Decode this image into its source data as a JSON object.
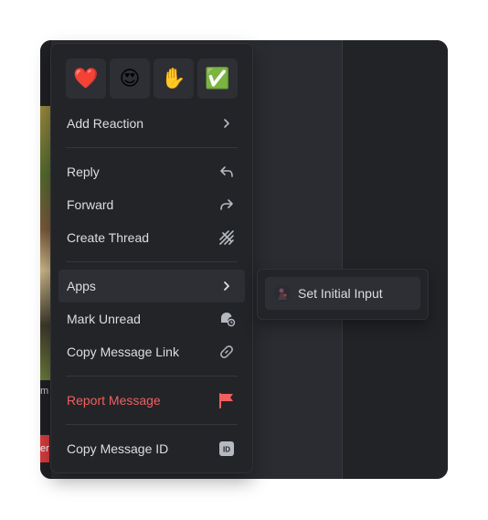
{
  "background": {
    "caption": "m",
    "red_button": "er"
  },
  "reactions": [
    {
      "name": "heart",
      "glyph": "❤️"
    },
    {
      "name": "heart-eyes",
      "glyph": "😍"
    },
    {
      "name": "raised-hand",
      "glyph": "✋"
    },
    {
      "name": "check-mark",
      "glyph": "✅"
    }
  ],
  "menu": {
    "add_reaction": "Add Reaction",
    "reply": "Reply",
    "forward": "Forward",
    "create_thread": "Create Thread",
    "apps": "Apps",
    "mark_unread": "Mark Unread",
    "copy_message_link": "Copy Message Link",
    "report_message": "Report Message",
    "copy_message_id": "Copy Message ID"
  },
  "submenu": {
    "set_initial_input": "Set Initial Input"
  },
  "colors": {
    "danger": "#f0605f",
    "menu_bg": "#232428",
    "hover_bg": "#2e2f35"
  }
}
